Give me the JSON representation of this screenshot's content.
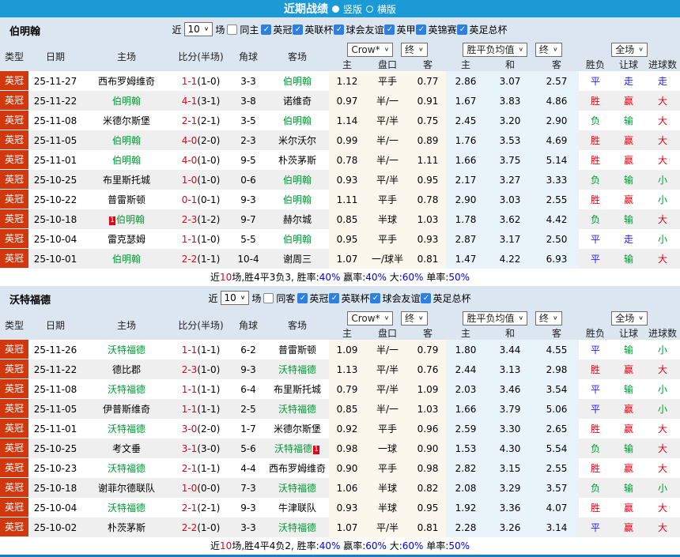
{
  "topbar": {
    "title": "近期战绩",
    "vertical_label": "竖版",
    "horizontal_label": "横版"
  },
  "colors": {
    "topbar": "#1b9ad6",
    "sechead": "#dce6f1",
    "badge": "#d1380e",
    "cream": "#fcf7ec",
    "bluecol": "#e9f3fa",
    "stripe": "#efefef",
    "bottomline": "#1a7fc1",
    "cbblue": "#2d7fe0",
    "red": "#e60012",
    "green": "#009933",
    "blue": "#2222ee",
    "linkblue": "#0000e6"
  },
  "table_header": {
    "type": "类型",
    "date": "日期",
    "home": "主场",
    "score": "比分(半场)",
    "corner": "角球",
    "away": "客场",
    "crow_select": "Crow*",
    "final_select": "终",
    "avg_select": "胜平负均值",
    "final_select2": "终",
    "scope_select": "全场",
    "sub": {
      "home": "主",
      "handicap": "盘口",
      "away": "客",
      "avg_home": "主",
      "avg_draw": "和",
      "avg_away": "客",
      "result": "胜负",
      "handicap_result": "让球",
      "goals": "进球数"
    }
  },
  "result_colors": {
    "胜": "#e60012",
    "赢": "#e60012",
    "大": "#e60012",
    "负": "#009933",
    "输": "#009933",
    "小": "#009933",
    "平": "#2222ee",
    "走": "#2222ee"
  },
  "check_glyph": "✓",
  "chevron_glyph": "∨",
  "sections": [
    {
      "team": "伯明翰",
      "filter": {
        "near": "近",
        "count": "10",
        "games": "场",
        "same": "同主",
        "same_checked": false,
        "leagues": [
          "英冠",
          "英联杯",
          "球会友谊",
          "英甲",
          "英锦赛",
          "英足总杯"
        ]
      },
      "rows": [
        {
          "type": "英冠",
          "date": "25-11-27",
          "home": "西布罗姆维奇",
          "home_card": "",
          "score": "1-1",
          "half": "(1-0)",
          "corner": "3-3",
          "away": "伯明翰",
          "away_card": "",
          "crow": [
            "1.12",
            "平手",
            "0.77"
          ],
          "avg": [
            "2.86",
            "3.07",
            "2.57"
          ],
          "res": [
            "平",
            "走",
            "走"
          ]
        },
        {
          "type": "英冠",
          "date": "25-11-22",
          "home": "伯明翰",
          "home_card": "",
          "score": "4-1",
          "half": "(3-1)",
          "corner": "3-8",
          "away": "诺维奇",
          "away_card": "",
          "crow": [
            "0.97",
            "半/一",
            "0.91"
          ],
          "avg": [
            "1.67",
            "3.83",
            "4.86"
          ],
          "res": [
            "胜",
            "赢",
            "大"
          ]
        },
        {
          "type": "英冠",
          "date": "25-11-08",
          "home": "米德尔斯堡",
          "home_card": "",
          "score": "2-1",
          "half": "(2-1)",
          "corner": "3-5",
          "away": "伯明翰",
          "away_card": "",
          "crow": [
            "1.14",
            "平/半",
            "0.75"
          ],
          "avg": [
            "2.45",
            "3.20",
            "2.90"
          ],
          "res": [
            "负",
            "输",
            "大"
          ]
        },
        {
          "type": "英冠",
          "date": "25-11-05",
          "home": "伯明翰",
          "home_card": "",
          "score": "4-0",
          "half": "(2-0)",
          "corner": "2-3",
          "away": "米尔沃尔",
          "away_card": "",
          "crow": [
            "0.99",
            "半/一",
            "0.89"
          ],
          "avg": [
            "1.76",
            "3.53",
            "4.69"
          ],
          "res": [
            "胜",
            "赢",
            "大"
          ]
        },
        {
          "type": "英冠",
          "date": "25-11-01",
          "home": "伯明翰",
          "home_card": "",
          "score": "4-0",
          "half": "(1-0)",
          "corner": "9-5",
          "away": "朴茨茅斯",
          "away_card": "",
          "crow": [
            "0.78",
            "半/一",
            "1.11"
          ],
          "avg": [
            "1.66",
            "3.75",
            "5.14"
          ],
          "res": [
            "胜",
            "赢",
            "大"
          ]
        },
        {
          "type": "英冠",
          "date": "25-10-25",
          "home": "布里斯托城",
          "home_card": "",
          "score": "1-0",
          "half": "(1-0)",
          "corner": "0-6",
          "away": "伯明翰",
          "away_card": "",
          "crow": [
            "0.93",
            "平/半",
            "0.95"
          ],
          "avg": [
            "2.17",
            "3.27",
            "3.33"
          ],
          "res": [
            "负",
            "输",
            "小"
          ]
        },
        {
          "type": "英冠",
          "date": "25-10-22",
          "home": "普雷斯顿",
          "home_card": "",
          "score": "0-1",
          "half": "(0-1)",
          "corner": "9-3",
          "away": "伯明翰",
          "away_card": "",
          "crow": [
            "1.11",
            "平手",
            "0.78"
          ],
          "avg": [
            "2.90",
            "3.03",
            "2.55"
          ],
          "res": [
            "胜",
            "赢",
            "小"
          ]
        },
        {
          "type": "英冠",
          "date": "25-10-18",
          "home": "伯明翰",
          "home_card": "1",
          "score": "2-3",
          "half": "(1-2)",
          "corner": "9-7",
          "away": "赫尔城",
          "away_card": "",
          "crow": [
            "0.85",
            "半球",
            "1.03"
          ],
          "avg": [
            "1.78",
            "3.62",
            "4.42"
          ],
          "res": [
            "负",
            "输",
            "大"
          ]
        },
        {
          "type": "英冠",
          "date": "25-10-04",
          "home": "雷克瑟姆",
          "home_card": "",
          "score": "1-1",
          "half": "(1-0)",
          "corner": "5-5",
          "away": "伯明翰",
          "away_card": "",
          "crow": [
            "0.95",
            "平手",
            "0.93"
          ],
          "avg": [
            "2.87",
            "3.17",
            "2.50"
          ],
          "res": [
            "平",
            "走",
            "小"
          ]
        },
        {
          "type": "英冠",
          "date": "25-10-01",
          "home": "伯明翰",
          "home_card": "",
          "score": "2-2",
          "half": "(1-1)",
          "corner": "10-4",
          "away": "谢周三",
          "away_card": "",
          "crow": [
            "1.07",
            "一/球半",
            "0.81"
          ],
          "avg": [
            "1.47",
            "4.22",
            "6.93"
          ],
          "res": [
            "平",
            "输",
            "大"
          ]
        }
      ],
      "summary_segments": [
        {
          "t": "近",
          "c": "k"
        },
        {
          "t": "10",
          "c": "r"
        },
        {
          "t": "场,胜4平3负3, 胜率:",
          "c": "k"
        },
        {
          "t": "40%",
          "c": "b"
        },
        {
          "t": " 赢率:",
          "c": "k"
        },
        {
          "t": "40%",
          "c": "b"
        },
        {
          "t": " 大:",
          "c": "k"
        },
        {
          "t": "60%",
          "c": "b"
        },
        {
          "t": " 单率:",
          "c": "k"
        },
        {
          "t": "50%",
          "c": "b"
        }
      ]
    },
    {
      "team": "沃特福德",
      "filter": {
        "near": "近",
        "count": "10",
        "games": "场",
        "same": "同客",
        "same_checked": false,
        "leagues": [
          "英冠",
          "英联杯",
          "球会友谊",
          "英足总杯"
        ]
      },
      "rows": [
        {
          "type": "英冠",
          "date": "25-11-26",
          "home": "沃特福德",
          "home_card": "",
          "score": "1-1",
          "half": "(1-1)",
          "corner": "6-2",
          "away": "普雷斯顿",
          "away_card": "",
          "crow": [
            "1.09",
            "半/一",
            "0.79"
          ],
          "avg": [
            "1.80",
            "3.44",
            "4.55"
          ],
          "res": [
            "平",
            "输",
            "小"
          ]
        },
        {
          "type": "英冠",
          "date": "25-11-22",
          "home": "德比郡",
          "home_card": "",
          "score": "2-3",
          "half": "(1-0)",
          "corner": "9-3",
          "away": "沃特福德",
          "away_card": "",
          "crow": [
            "1.13",
            "平/半",
            "0.76"
          ],
          "avg": [
            "2.44",
            "3.13",
            "2.98"
          ],
          "res": [
            "胜",
            "赢",
            "大"
          ]
        },
        {
          "type": "英冠",
          "date": "25-11-08",
          "home": "沃特福德",
          "home_card": "",
          "score": "1-1",
          "half": "(1-1)",
          "corner": "6-4",
          "away": "布里斯托城",
          "away_card": "",
          "crow": [
            "0.79",
            "平/半",
            "1.09"
          ],
          "avg": [
            "2.03",
            "3.46",
            "3.54"
          ],
          "res": [
            "平",
            "输",
            "小"
          ]
        },
        {
          "type": "英冠",
          "date": "25-11-05",
          "home": "伊普斯维奇",
          "home_card": "",
          "score": "1-1",
          "half": "(1-1)",
          "corner": "2-5",
          "away": "沃特福德",
          "away_card": "",
          "crow": [
            "0.85",
            "半/一",
            "1.03"
          ],
          "avg": [
            "1.66",
            "3.79",
            "5.06"
          ],
          "res": [
            "平",
            "赢",
            "小"
          ]
        },
        {
          "type": "英冠",
          "date": "25-11-01",
          "home": "沃特福德",
          "home_card": "",
          "score": "3-0",
          "half": "(2-0)",
          "corner": "1-7",
          "away": "米德尔斯堡",
          "away_card": "",
          "crow": [
            "0.92",
            "平手",
            "0.96"
          ],
          "avg": [
            "2.59",
            "3.30",
            "2.65"
          ],
          "res": [
            "胜",
            "赢",
            "大"
          ]
        },
        {
          "type": "英冠",
          "date": "25-10-25",
          "home": "考文垂",
          "home_card": "",
          "score": "3-1",
          "half": "(3-0)",
          "corner": "5-6",
          "away": "沃特福德",
          "away_card": "1",
          "crow": [
            "0.98",
            "一球",
            "0.90"
          ],
          "avg": [
            "1.53",
            "4.30",
            "5.54"
          ],
          "res": [
            "负",
            "输",
            "大"
          ]
        },
        {
          "type": "英冠",
          "date": "25-10-23",
          "home": "沃特福德",
          "home_card": "",
          "score": "2-1",
          "half": "(1-1)",
          "corner": "4-4",
          "away": "西布罗姆维奇",
          "away_card": "",
          "crow": [
            "0.90",
            "平手",
            "0.98"
          ],
          "avg": [
            "2.82",
            "3.15",
            "2.55"
          ],
          "res": [
            "胜",
            "赢",
            "大"
          ]
        },
        {
          "type": "英冠",
          "date": "25-10-18",
          "home": "谢菲尔德联队",
          "home_card": "",
          "score": "1-0",
          "half": "(0-0)",
          "corner": "7-3",
          "away": "沃特福德",
          "away_card": "",
          "crow": [
            "1.06",
            "半球",
            "0.82"
          ],
          "avg": [
            "2.08",
            "3.29",
            "3.57"
          ],
          "res": [
            "负",
            "输",
            "小"
          ]
        },
        {
          "type": "英冠",
          "date": "25-10-04",
          "home": "沃特福德",
          "home_card": "",
          "score": "2-1",
          "half": "(2-1)",
          "corner": "9-3",
          "away": "牛津联队",
          "away_card": "",
          "crow": [
            "0.93",
            "半球",
            "0.95"
          ],
          "avg": [
            "1.92",
            "3.36",
            "4.07"
          ],
          "res": [
            "胜",
            "赢",
            "大"
          ]
        },
        {
          "type": "英冠",
          "date": "25-10-02",
          "home": "朴茨茅斯",
          "home_card": "",
          "score": "2-2",
          "half": "(1-0)",
          "corner": "3-3",
          "away": "沃特福德",
          "away_card": "",
          "crow": [
            "1.07",
            "平/半",
            "0.81"
          ],
          "avg": [
            "2.28",
            "3.26",
            "3.14"
          ],
          "res": [
            "平",
            "赢",
            "大"
          ]
        }
      ],
      "summary_segments": [
        {
          "t": "近",
          "c": "k"
        },
        {
          "t": "10",
          "c": "r"
        },
        {
          "t": "场,胜4平4负2, 胜率:",
          "c": "k"
        },
        {
          "t": "40%",
          "c": "b"
        },
        {
          "t": " 赢率:",
          "c": "k"
        },
        {
          "t": "60%",
          "c": "b"
        },
        {
          "t": " 大:",
          "c": "k"
        },
        {
          "t": "60%",
          "c": "b"
        },
        {
          "t": " 单率:",
          "c": "k"
        },
        {
          "t": "50%",
          "c": "b"
        }
      ]
    }
  ]
}
